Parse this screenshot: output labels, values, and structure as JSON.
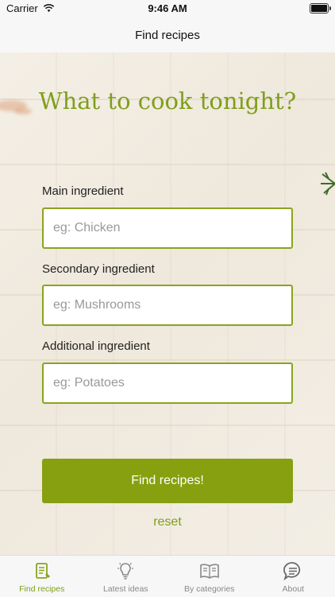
{
  "status_bar": {
    "carrier": "Carrier",
    "time": "9:46 AM"
  },
  "nav": {
    "title": "Find recipes"
  },
  "headline": "What to cook tonight?",
  "form": {
    "main": {
      "label": "Main ingredient",
      "placeholder": "eg: Chicken",
      "value": ""
    },
    "secondary": {
      "label": "Secondary ingredient",
      "placeholder": "eg: Mushrooms",
      "value": ""
    },
    "additional": {
      "label": "Additional ingredient",
      "placeholder": "eg: Potatoes",
      "value": ""
    },
    "submit_label": "Find recipes!",
    "reset_label": "reset"
  },
  "tabs": [
    {
      "label": "Find recipes",
      "icon": "recipe-book-icon",
      "active": true
    },
    {
      "label": "Latest ideas",
      "icon": "lightbulb-icon",
      "active": false
    },
    {
      "label": "By categories",
      "icon": "open-book-icon",
      "active": false
    },
    {
      "label": "About",
      "icon": "chat-bubble-icon",
      "active": false
    }
  ],
  "colors": {
    "accent": "#86a00f",
    "accent_text": "#7f9f1a",
    "inactive": "#888888"
  }
}
